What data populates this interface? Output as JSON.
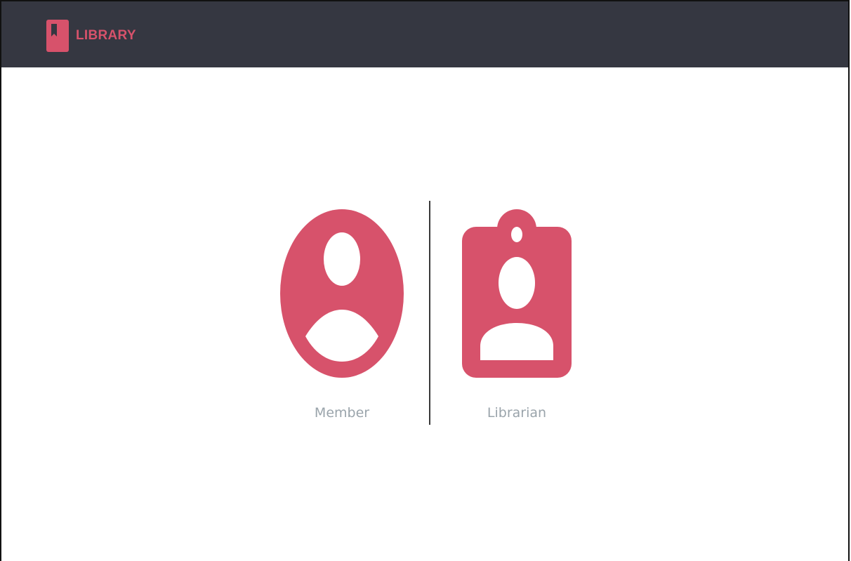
{
  "brand": {
    "name": "LIBRARY",
    "icon": "bookmark-book-icon",
    "color": "#d7526b"
  },
  "navbar": {
    "background": "#353741"
  },
  "roles": [
    {
      "label": "Member",
      "icon": "user-avatar-icon"
    },
    {
      "label": "Librarian",
      "icon": "id-badge-icon"
    }
  ],
  "colors": {
    "accent": "#d7526b",
    "label": "#9aa4ab",
    "divider": "#3a3a3a"
  }
}
